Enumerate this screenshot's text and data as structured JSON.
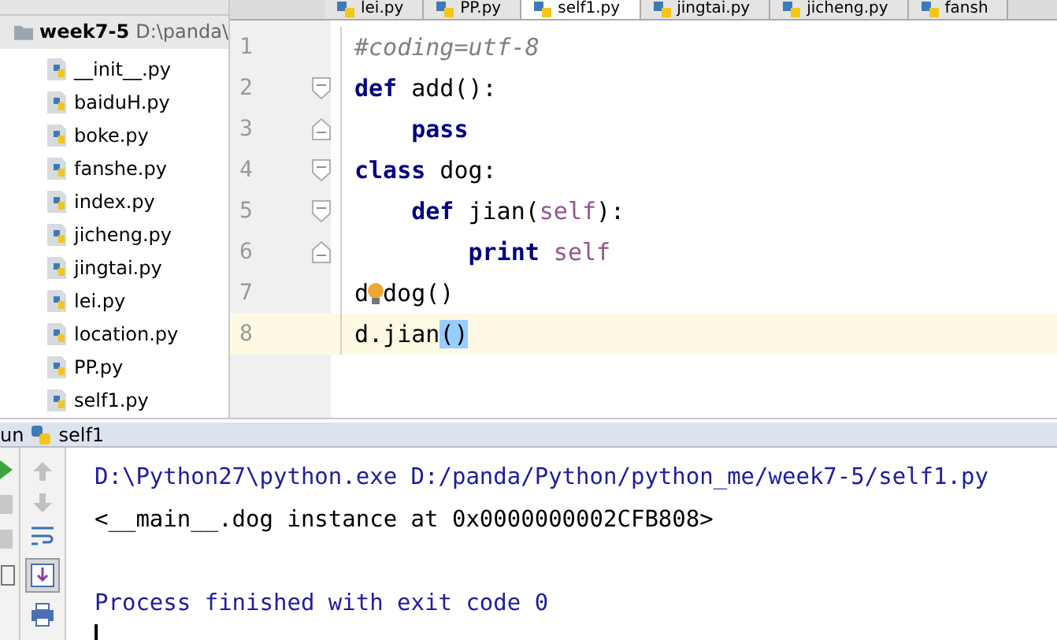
{
  "project": {
    "root": "week7-5",
    "root_path": "D:\\panda\\",
    "files": [
      {
        "name": "__init__.py"
      },
      {
        "name": "baiduH.py"
      },
      {
        "name": "boke.py"
      },
      {
        "name": "fanshe.py"
      },
      {
        "name": "index.py"
      },
      {
        "name": "jicheng.py"
      },
      {
        "name": "jingtai.py"
      },
      {
        "name": "lei.py"
      },
      {
        "name": "location.py"
      },
      {
        "name": "PP.py"
      },
      {
        "name": "self1.py"
      }
    ]
  },
  "tabs": [
    {
      "label": "lei.py",
      "selected": false
    },
    {
      "label": "PP.py",
      "selected": false
    },
    {
      "label": "self1.py",
      "selected": true
    },
    {
      "label": "jingtai.py",
      "selected": false
    },
    {
      "label": "jicheng.py",
      "selected": false
    },
    {
      "label": "fansh",
      "selected": false
    }
  ],
  "editor": {
    "lines": [
      {
        "number": "1",
        "kind": "plain",
        "current": false,
        "tokens": [
          {
            "kind": "comment",
            "text": "#coding=utf-8"
          }
        ]
      },
      {
        "number": "2",
        "kind": "fold_start",
        "current": false,
        "tokens": [
          {
            "kind": "keyword",
            "text": "def"
          },
          {
            "kind": "plain",
            "text": " add():"
          }
        ]
      },
      {
        "number": "3",
        "kind": "fold_end",
        "current": false,
        "tokens": [
          {
            "kind": "keyword",
            "text": "    pass"
          }
        ]
      },
      {
        "number": "4",
        "kind": "fold_start",
        "current": false,
        "tokens": [
          {
            "kind": "keyword",
            "text": "class"
          },
          {
            "kind": "plain",
            "text": " dog:"
          }
        ]
      },
      {
        "number": "5",
        "kind": "fold_start",
        "current": false,
        "tokens": [
          {
            "kind": "keyword",
            "text": "    def"
          },
          {
            "kind": "plain",
            "text": " jian("
          },
          {
            "kind": "self",
            "text": "self"
          },
          {
            "kind": "plain",
            "text": "):"
          }
        ]
      },
      {
        "number": "6",
        "kind": "fold_end",
        "current": false,
        "tokens": [
          {
            "kind": "keyword",
            "text": "        print"
          },
          {
            "kind": "self",
            "text": " self"
          }
        ]
      },
      {
        "number": "7",
        "kind": "plain",
        "current": false,
        "tokens": [
          {
            "kind": "plain",
            "text": "d"
          },
          {
            "kind": "bulb"
          },
          {
            "kind": "plain",
            "text": "dog()"
          }
        ]
      },
      {
        "number": "8",
        "kind": "plain",
        "current": true,
        "tokens": [
          {
            "kind": "plain",
            "text": "d.jian"
          },
          {
            "kind": "match",
            "text": "()"
          }
        ]
      }
    ]
  },
  "run": {
    "label": "un",
    "config": "self1",
    "output": [
      {
        "kind": "system",
        "text": "D:\\Python27\\python.exe D:/panda/Python/python_me/week7-5/self1.py"
      },
      {
        "kind": "stdout",
        "text": "<__main__.dog instance at 0x0000000002CFB808>"
      },
      {
        "kind": "blank"
      },
      {
        "kind": "system",
        "text": "Process finished with exit code 0"
      }
    ]
  }
}
